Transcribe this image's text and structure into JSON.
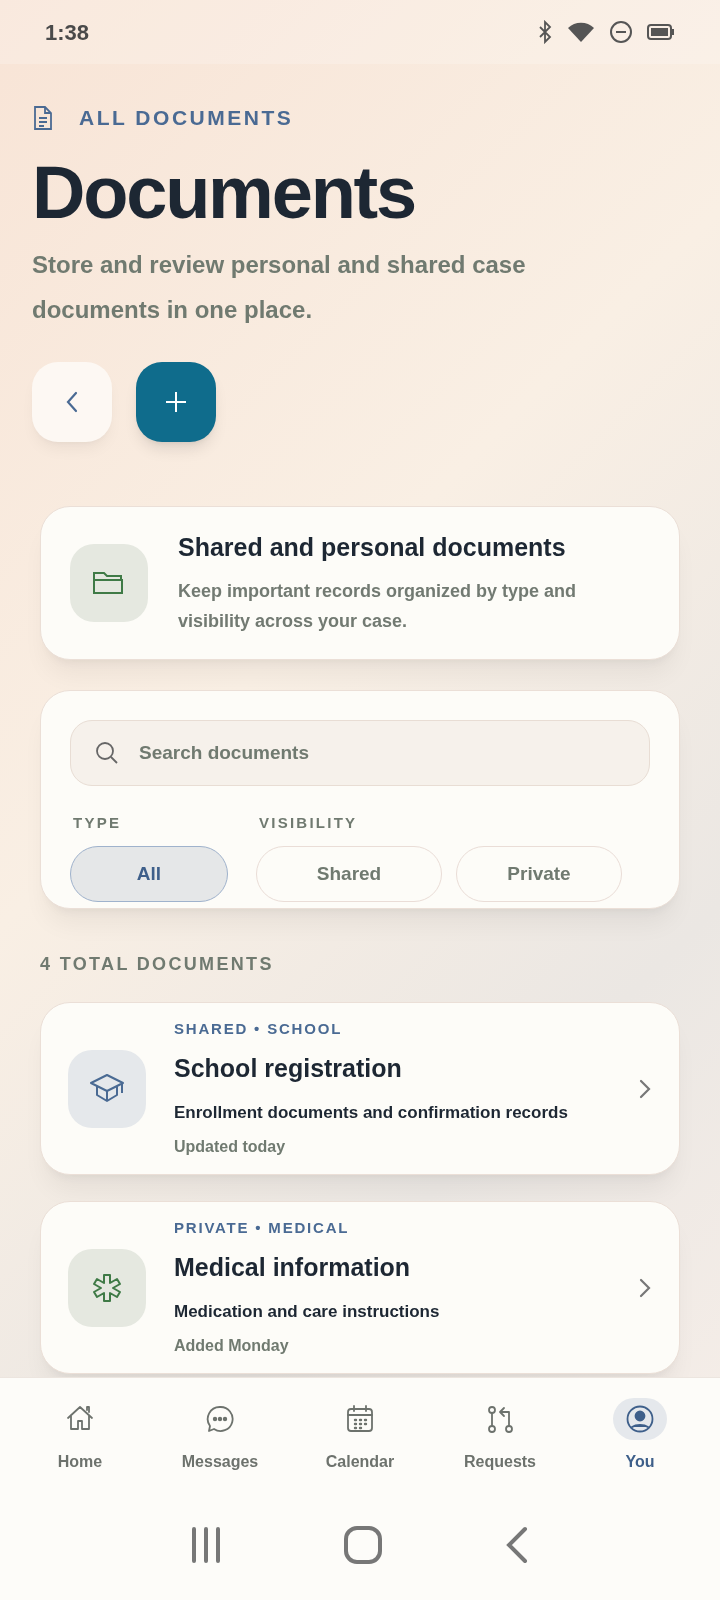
{
  "status_bar": {
    "time": "1:38"
  },
  "header": {
    "eyebrow": "ALL DOCUMENTS",
    "title": "Documents",
    "subtitle": "Store and review personal and shared case documents in one place."
  },
  "intro_card": {
    "title": "Shared and personal documents",
    "text": "Keep important records organized by type and visibility across your case."
  },
  "search": {
    "placeholder": "Search documents"
  },
  "filter_groups": [
    {
      "label": "TYPE",
      "chips": [
        {
          "label": "All",
          "selected": true
        }
      ]
    },
    {
      "label": "VISIBILITY",
      "chips": [
        {
          "label": "Shared",
          "selected": false
        },
        {
          "label": "Private",
          "selected": false
        }
      ]
    }
  ],
  "count_label": "4 TOTAL DOCUMENTS",
  "documents": [
    {
      "kind": "school",
      "tag": "SHARED • SCHOOL",
      "title": "School registration",
      "description": "Enrollment documents and confirmation records",
      "meta": "Updated today"
    },
    {
      "kind": "medical",
      "tag": "PRIVATE • MEDICAL",
      "title": "Medical information",
      "description": "Medication and care instructions",
      "meta": "Added Monday"
    }
  ],
  "nav": [
    {
      "kind": "home",
      "label": "Home",
      "selected": false
    },
    {
      "kind": "messages",
      "label": "Messages",
      "selected": false
    },
    {
      "kind": "calendar",
      "label": "Calendar",
      "selected": false
    },
    {
      "kind": "requests",
      "label": "Requests",
      "selected": false
    },
    {
      "kind": "you",
      "label": "You",
      "selected": true
    }
  ]
}
